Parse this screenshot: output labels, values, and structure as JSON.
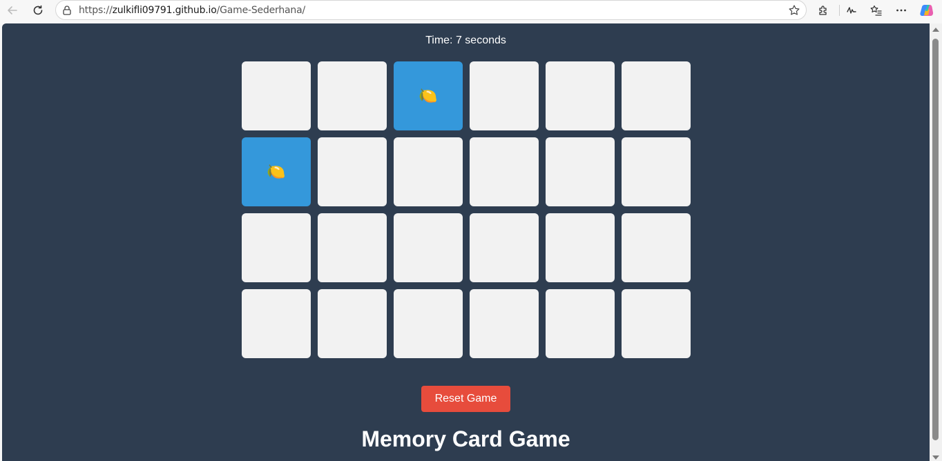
{
  "browser": {
    "url_prefix": "https://",
    "url_host": "zulkifli09791.github.io",
    "url_path": "/Game-Sederhana/"
  },
  "game": {
    "timer_text": "Time: 7 seconds",
    "reset_label": "Reset Game",
    "title": "Memory Card Game",
    "colors": {
      "background": "#2e3d50",
      "card_back": "#f2f2f2",
      "card_flipped": "#3498db",
      "reset_button": "#e74c3c"
    },
    "cards": [
      {
        "flipped": false,
        "symbol": ""
      },
      {
        "flipped": false,
        "symbol": ""
      },
      {
        "flipped": true,
        "symbol": "🍋"
      },
      {
        "flipped": false,
        "symbol": ""
      },
      {
        "flipped": false,
        "symbol": ""
      },
      {
        "flipped": false,
        "symbol": ""
      },
      {
        "flipped": true,
        "symbol": "🍋"
      },
      {
        "flipped": false,
        "symbol": ""
      },
      {
        "flipped": false,
        "symbol": ""
      },
      {
        "flipped": false,
        "symbol": ""
      },
      {
        "flipped": false,
        "symbol": ""
      },
      {
        "flipped": false,
        "symbol": ""
      },
      {
        "flipped": false,
        "symbol": ""
      },
      {
        "flipped": false,
        "symbol": ""
      },
      {
        "flipped": false,
        "symbol": ""
      },
      {
        "flipped": false,
        "symbol": ""
      },
      {
        "flipped": false,
        "symbol": ""
      },
      {
        "flipped": false,
        "symbol": ""
      },
      {
        "flipped": false,
        "symbol": ""
      },
      {
        "flipped": false,
        "symbol": ""
      },
      {
        "flipped": false,
        "symbol": ""
      },
      {
        "flipped": false,
        "symbol": ""
      },
      {
        "flipped": false,
        "symbol": ""
      },
      {
        "flipped": false,
        "symbol": ""
      }
    ]
  }
}
